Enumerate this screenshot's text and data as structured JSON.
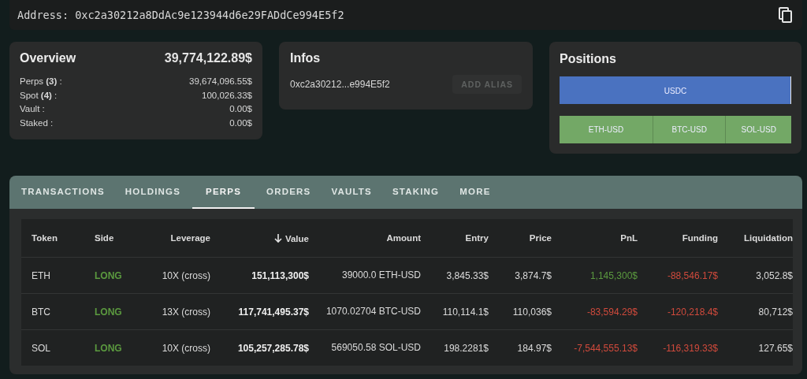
{
  "address": {
    "label": "Address:",
    "value": "0xc2a30212a8DdAc9e123944d6e29FADdCe994E5f2"
  },
  "overview": {
    "title": "Overview",
    "total": "39,774,122.89$",
    "items": [
      {
        "label": "Perps **(3)** :",
        "value": "39,674,096.55$"
      },
      {
        "label": "Spot **(4)** :",
        "value": "100,026.33$"
      },
      {
        "label": "Vault :",
        "value": "0.00$"
      },
      {
        "label": "Staked :",
        "value": "0.00$"
      }
    ]
  },
  "infos": {
    "title": "Infos",
    "short_address": "0xc2a30212...e994E5f2",
    "button": {
      "label": "ADD ALIAS",
      "disabled": true
    }
  },
  "positions": {
    "title": "Positions",
    "balance_bar": {
      "label": "USDC",
      "level": 0.996
    },
    "segments": [
      {
        "label": "ETH-USD"
      },
      {
        "label": "BTC-USD"
      },
      {
        "label": "SOL-USD"
      }
    ]
  },
  "tabs": [
    {
      "label": "TRANSACTIONS",
      "selected": false
    },
    {
      "label": "HOLDINGS",
      "selected": false
    },
    {
      "label": "PERPS",
      "selected": true
    },
    {
      "label": "ORDERS",
      "selected": false
    },
    {
      "label": "VAULTS",
      "selected": false
    },
    {
      "label": "STAKING",
      "selected": false
    },
    {
      "label": "MORE",
      "selected": false
    }
  ],
  "table": {
    "columns": [
      {
        "label": "Token",
        "sorted": false
      },
      {
        "label": "Side",
        "sorted": false
      },
      {
        "label": "Leverage",
        "sorted": false
      },
      {
        "label": "Value",
        "sorted": true
      },
      {
        "label": "Amount",
        "sorted": false
      },
      {
        "label": "Entry",
        "sorted": false
      },
      {
        "label": "Price",
        "sorted": false
      },
      {
        "label": "PnL",
        "sorted": false
      },
      {
        "label": "Funding",
        "sorted": false
      },
      {
        "label": "Liquidation",
        "sorted": false
      }
    ],
    "rows": [
      [
        "ETH",
        {
          "text": "LONG",
          "color": "#5b9a3f"
        },
        "10X (cross)",
        "151,113,300$",
        "39000.0 ETH-USD",
        "3,845.33$",
        "3,874.7$",
        {
          "text": "1,145,300$",
          "color": "#5b9a3f"
        },
        {
          "text": "-88,546.17$",
          "color": "#d04a3c"
        },
        "3,052.8$"
      ],
      [
        "BTC",
        {
          "text": "LONG",
          "color": "#5b9a3f"
        },
        "13X (cross)",
        "117,741,495.37$",
        "1070.02704 BTC-USD",
        "110,114.1$",
        "110,036$",
        {
          "text": "-83,594.29$",
          "color": "#d04a3c"
        },
        {
          "text": "-120,218.4$",
          "color": "#d04a3c"
        },
        "80,712$"
      ],
      [
        "SOL",
        {
          "text": "LONG",
          "color": "#5b9a3f"
        },
        "10X (cross)",
        "105,257,285.78$",
        "569050.58 SOL-USD",
        "198.2281$",
        "184.97$",
        {
          "text": "-7,544,555.13$",
          "color": "#d04a3c"
        },
        {
          "text": "-116,319.33$",
          "color": "#d04a3c"
        },
        "127.65$"
      ]
    ]
  }
}
